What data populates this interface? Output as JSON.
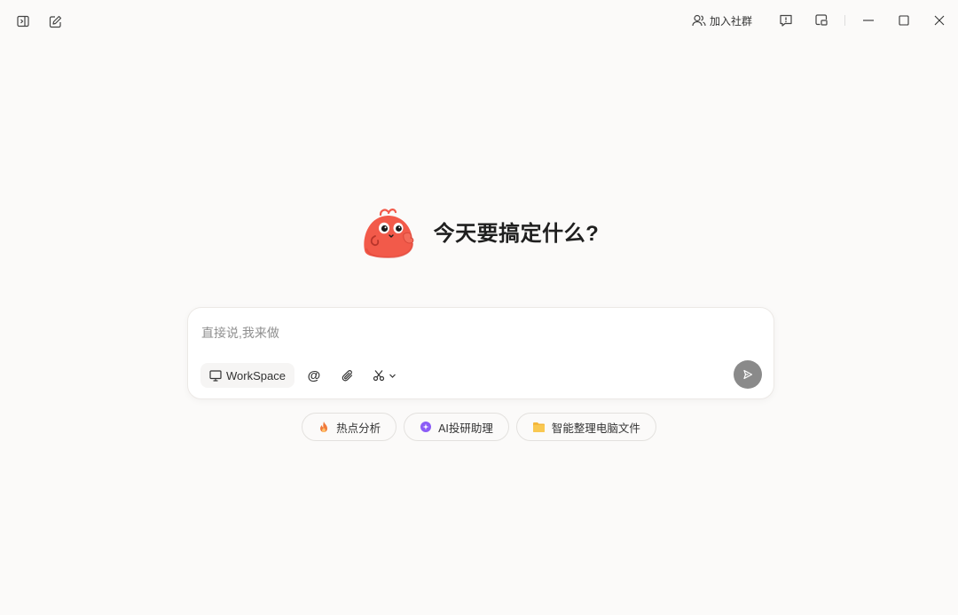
{
  "titlebar": {
    "community_label": "加入社群",
    "icons": {
      "sidebar_toggle": "sidebar-toggle-icon",
      "new_chat": "edit-icon",
      "community": "users-icon",
      "feedback": "feedback-icon",
      "pip": "picture-in-picture-icon"
    },
    "window_controls": [
      "minimize",
      "maximize",
      "close"
    ]
  },
  "hero": {
    "title": "今天要搞定什么?"
  },
  "composer": {
    "placeholder": "直接说,我来做",
    "workspace_label": "WorkSpace",
    "tools": [
      "at-icon",
      "paperclip-icon",
      "scissors-icon",
      "chevron-down-icon"
    ],
    "send_icon": "send-icon"
  },
  "suggestions": [
    {
      "label": "热点分析",
      "icon": "flame-icon",
      "color": "#f07a3a"
    },
    {
      "label": "AI投研助理",
      "icon": "ai-sparkle-icon",
      "color": "#8b5cf6"
    },
    {
      "label": "智能整理电脑文件",
      "icon": "folder-icon",
      "color": "#f4b73a"
    }
  ],
  "colors": {
    "background": "#fbfaf9",
    "mascot": "#f25a4a",
    "send_disabled": "#8a8a8a"
  }
}
